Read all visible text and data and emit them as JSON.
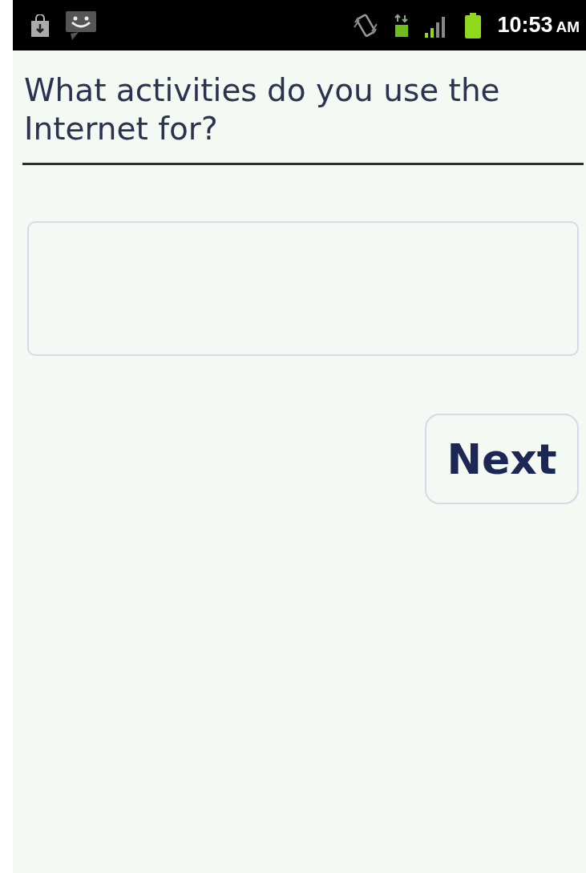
{
  "status_bar": {
    "time": "10:53",
    "meridiem": "AM"
  },
  "question": {
    "text": "What activities do you use the Internet for?"
  },
  "buttons": [
    {
      "label": "Next"
    }
  ]
}
